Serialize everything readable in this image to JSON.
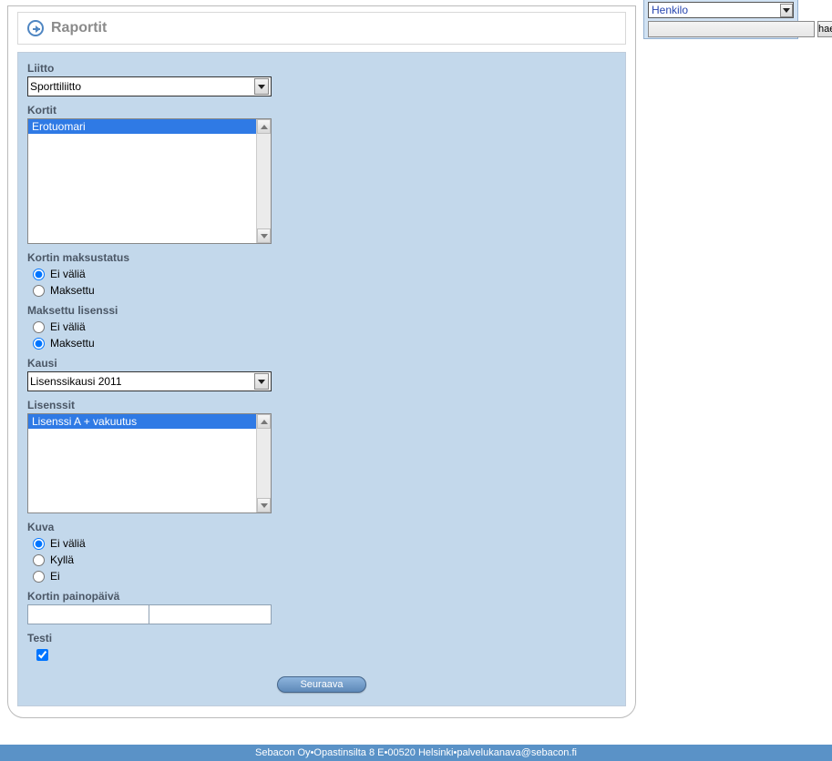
{
  "header": {
    "title": "Raportit"
  },
  "sideSearch": {
    "selected": "Henkilo",
    "searchValue": "",
    "searchButton": "hae"
  },
  "form": {
    "liitto": {
      "label": "Liitto",
      "value": "Sporttiliitto"
    },
    "kortit": {
      "label": "Kortit",
      "items": [
        {
          "label": "Erotuomari",
          "selected": true
        }
      ]
    },
    "kortinMaksustatus": {
      "label": "Kortin maksustatus",
      "options": [
        {
          "label": "Ei väliä",
          "checked": true
        },
        {
          "label": "Maksettu",
          "checked": false
        }
      ]
    },
    "maksettuLisenssi": {
      "label": "Maksettu lisenssi",
      "options": [
        {
          "label": "Ei väliä",
          "checked": false
        },
        {
          "label": "Maksettu",
          "checked": true
        }
      ]
    },
    "kausi": {
      "label": "Kausi",
      "value": "Lisenssikausi 2011"
    },
    "lisenssit": {
      "label": "Lisenssit",
      "items": [
        {
          "label": "Lisenssi A + vakuutus",
          "selected": true
        }
      ]
    },
    "kuva": {
      "label": "Kuva",
      "options": [
        {
          "label": "Ei väliä",
          "checked": true
        },
        {
          "label": "Kyllä",
          "checked": false
        },
        {
          "label": "Ei",
          "checked": false
        }
      ]
    },
    "kortinPainopaiva": {
      "label": "Kortin painopäivä",
      "from": "",
      "to": ""
    },
    "testi": {
      "label": "Testi",
      "checked": true
    },
    "submit": "Seuraava"
  },
  "footer": {
    "company": "Sebacon Oy",
    "sep": " • ",
    "address1": "Opastinsilta 8 E",
    "address2": "00520 Helsinki",
    "email": "palvelukanava@sebacon.fi"
  }
}
